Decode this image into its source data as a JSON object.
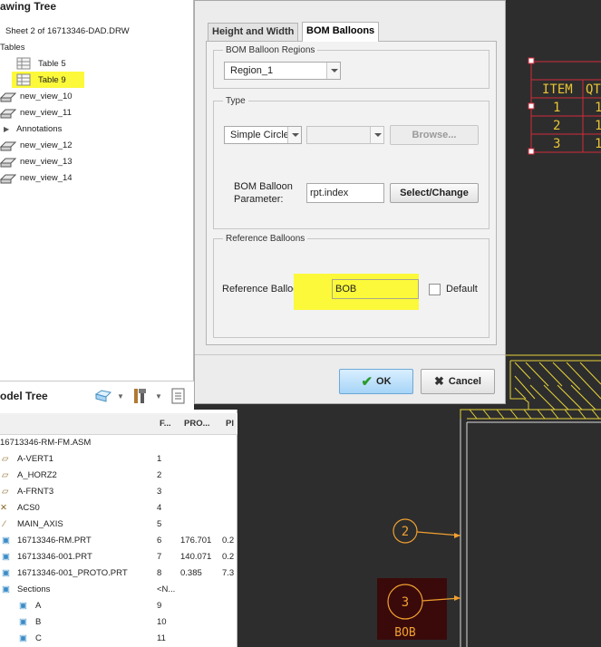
{
  "drawing_tree": {
    "title": "awing Tree",
    "items": [
      {
        "label": "Sheet 2 of 16713346-DAD.DRW"
      },
      {
        "label": "Tables"
      },
      {
        "label": "Table 5"
      },
      {
        "label": "Table 9"
      },
      {
        "label": "new_view_10"
      },
      {
        "label": "new_view_11"
      },
      {
        "label": "Annotations"
      },
      {
        "label": "new_view_12"
      },
      {
        "label": "new_view_13"
      },
      {
        "label": "new_view_14"
      }
    ]
  },
  "model_tree": {
    "title": "odel Tree",
    "columns": [
      "F...",
      "PRO...",
      "Pl"
    ],
    "rows": [
      {
        "name": "16713346-RM-FM.ASM",
        "f": "",
        "pro": "",
        "pl": ""
      },
      {
        "name": "A-VERT1",
        "f": "1",
        "pro": "",
        "pl": ""
      },
      {
        "name": "A_HORZ2",
        "f": "2",
        "pro": "",
        "pl": ""
      },
      {
        "name": "A-FRNT3",
        "f": "3",
        "pro": "",
        "pl": ""
      },
      {
        "name": "ACS0",
        "f": "4",
        "pro": "",
        "pl": ""
      },
      {
        "name": "MAIN_AXIS",
        "f": "5",
        "pro": "",
        "pl": ""
      },
      {
        "name": "16713346-RM.PRT",
        "f": "6",
        "pro": "176.701",
        "pl": "0.2"
      },
      {
        "name": "16713346-001.PRT",
        "f": "7",
        "pro": "140.071",
        "pl": "0.2"
      },
      {
        "name": "16713346-001_PROTO.PRT",
        "f": "8",
        "pro": "0.385",
        "pl": "7.3"
      },
      {
        "name": "Sections",
        "f": "<N...",
        "pro": "",
        "pl": ""
      },
      {
        "name": "A",
        "f": "9",
        "pro": "",
        "pl": ""
      },
      {
        "name": "B",
        "f": "10",
        "pro": "",
        "pl": ""
      },
      {
        "name": "C",
        "f": "11",
        "pro": "",
        "pl": ""
      }
    ]
  },
  "dialog": {
    "tabs": [
      "Height and Width",
      "BOM Balloons"
    ],
    "regions": {
      "legend": "BOM Balloon Regions",
      "value": "Region_1"
    },
    "type": {
      "legend": "Type",
      "shape_value": "Simple Circle",
      "second_value": "",
      "browse_label": "Browse...",
      "param_label_1": "BOM Balloon",
      "param_label_2": "Parameter:",
      "param_value": "rpt.index",
      "select_change_label": "Select/Change"
    },
    "reference": {
      "legend": "Reference Balloons",
      "text_label": "Reference Balloon Text",
      "text_value": "BOB",
      "default_label": "Default"
    },
    "ok_label": "OK",
    "cancel_label": "Cancel"
  },
  "drawing": {
    "bom_header": [
      "ITEM",
      "QT"
    ],
    "bom_items": [
      "1",
      "2",
      "3"
    ],
    "bom_qty": [
      "1",
      "1",
      "1"
    ],
    "balloon_2": "2",
    "balloon_3": "3",
    "balloon_3_text": "BOB"
  },
  "colors": {
    "highlight": "#fbf93a",
    "canvas": "#2d2d2d",
    "balloon": "#f0a030",
    "table_red": "#d22a3b"
  }
}
